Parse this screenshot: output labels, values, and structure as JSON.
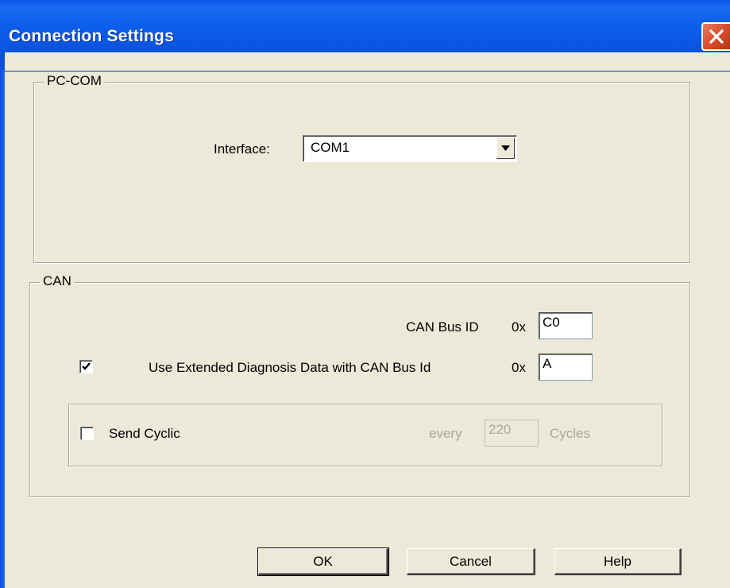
{
  "window": {
    "title": "Connection Settings"
  },
  "pc_com": {
    "legend": "PC-COM",
    "interface_label": "Interface:",
    "interface_value": "COM1"
  },
  "can": {
    "legend": "CAN",
    "bus_id_label": "CAN Bus ID",
    "bus_id_prefix": "0x",
    "bus_id_value": "C0",
    "extended_checked": true,
    "extended_label": "Use Extended Diagnosis Data with CAN Bus Id",
    "extended_prefix": "0x",
    "extended_value": "A",
    "send_cyclic_checked": false,
    "send_cyclic_label": "Send Cyclic",
    "every_label": "every",
    "every_value": "220",
    "cycles_label": "Cycles"
  },
  "buttons": {
    "ok": "OK",
    "cancel": "Cancel",
    "help": "Help"
  },
  "icons": {
    "close": "close-icon",
    "dropdown": "chevron-down-icon",
    "check": "check-icon"
  }
}
